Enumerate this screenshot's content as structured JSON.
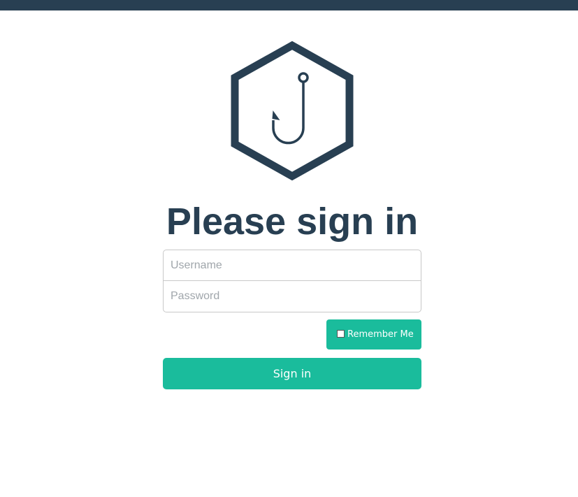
{
  "colors": {
    "navy": "#283f52",
    "teal": "#1abc9c",
    "white": "#ffffff"
  },
  "header": {
    "logo_icon": "fishhook-hexagon-icon"
  },
  "page": {
    "title": "Please sign in"
  },
  "form": {
    "username_placeholder": "Username",
    "password_placeholder": "Password",
    "remember_label": "Remember Me",
    "remember_checked": false,
    "signin_label": "Sign in"
  }
}
